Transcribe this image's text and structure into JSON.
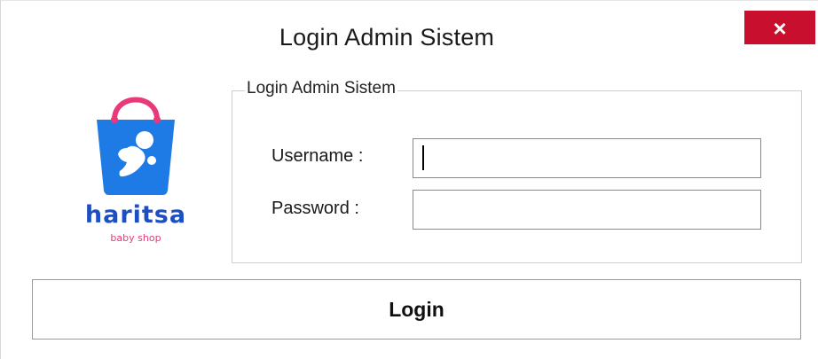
{
  "window": {
    "title": "Login Admin Sistem",
    "close_label": "×"
  },
  "brand": {
    "name": "haritsa",
    "tagline": "baby shop",
    "logo_icon": "shopping-bag-baby-icon",
    "colors": {
      "bag_blue": "#1e7be6",
      "handle_pink": "#e8397b",
      "name_blue": "#1d4fc2"
    }
  },
  "form": {
    "group_title": "Login Admin Sistem",
    "username_label": "Username :",
    "username_value": "",
    "password_label": "Password :",
    "password_value": ""
  },
  "actions": {
    "login_label": "Login"
  },
  "colors": {
    "close_button": "#c8102e"
  }
}
